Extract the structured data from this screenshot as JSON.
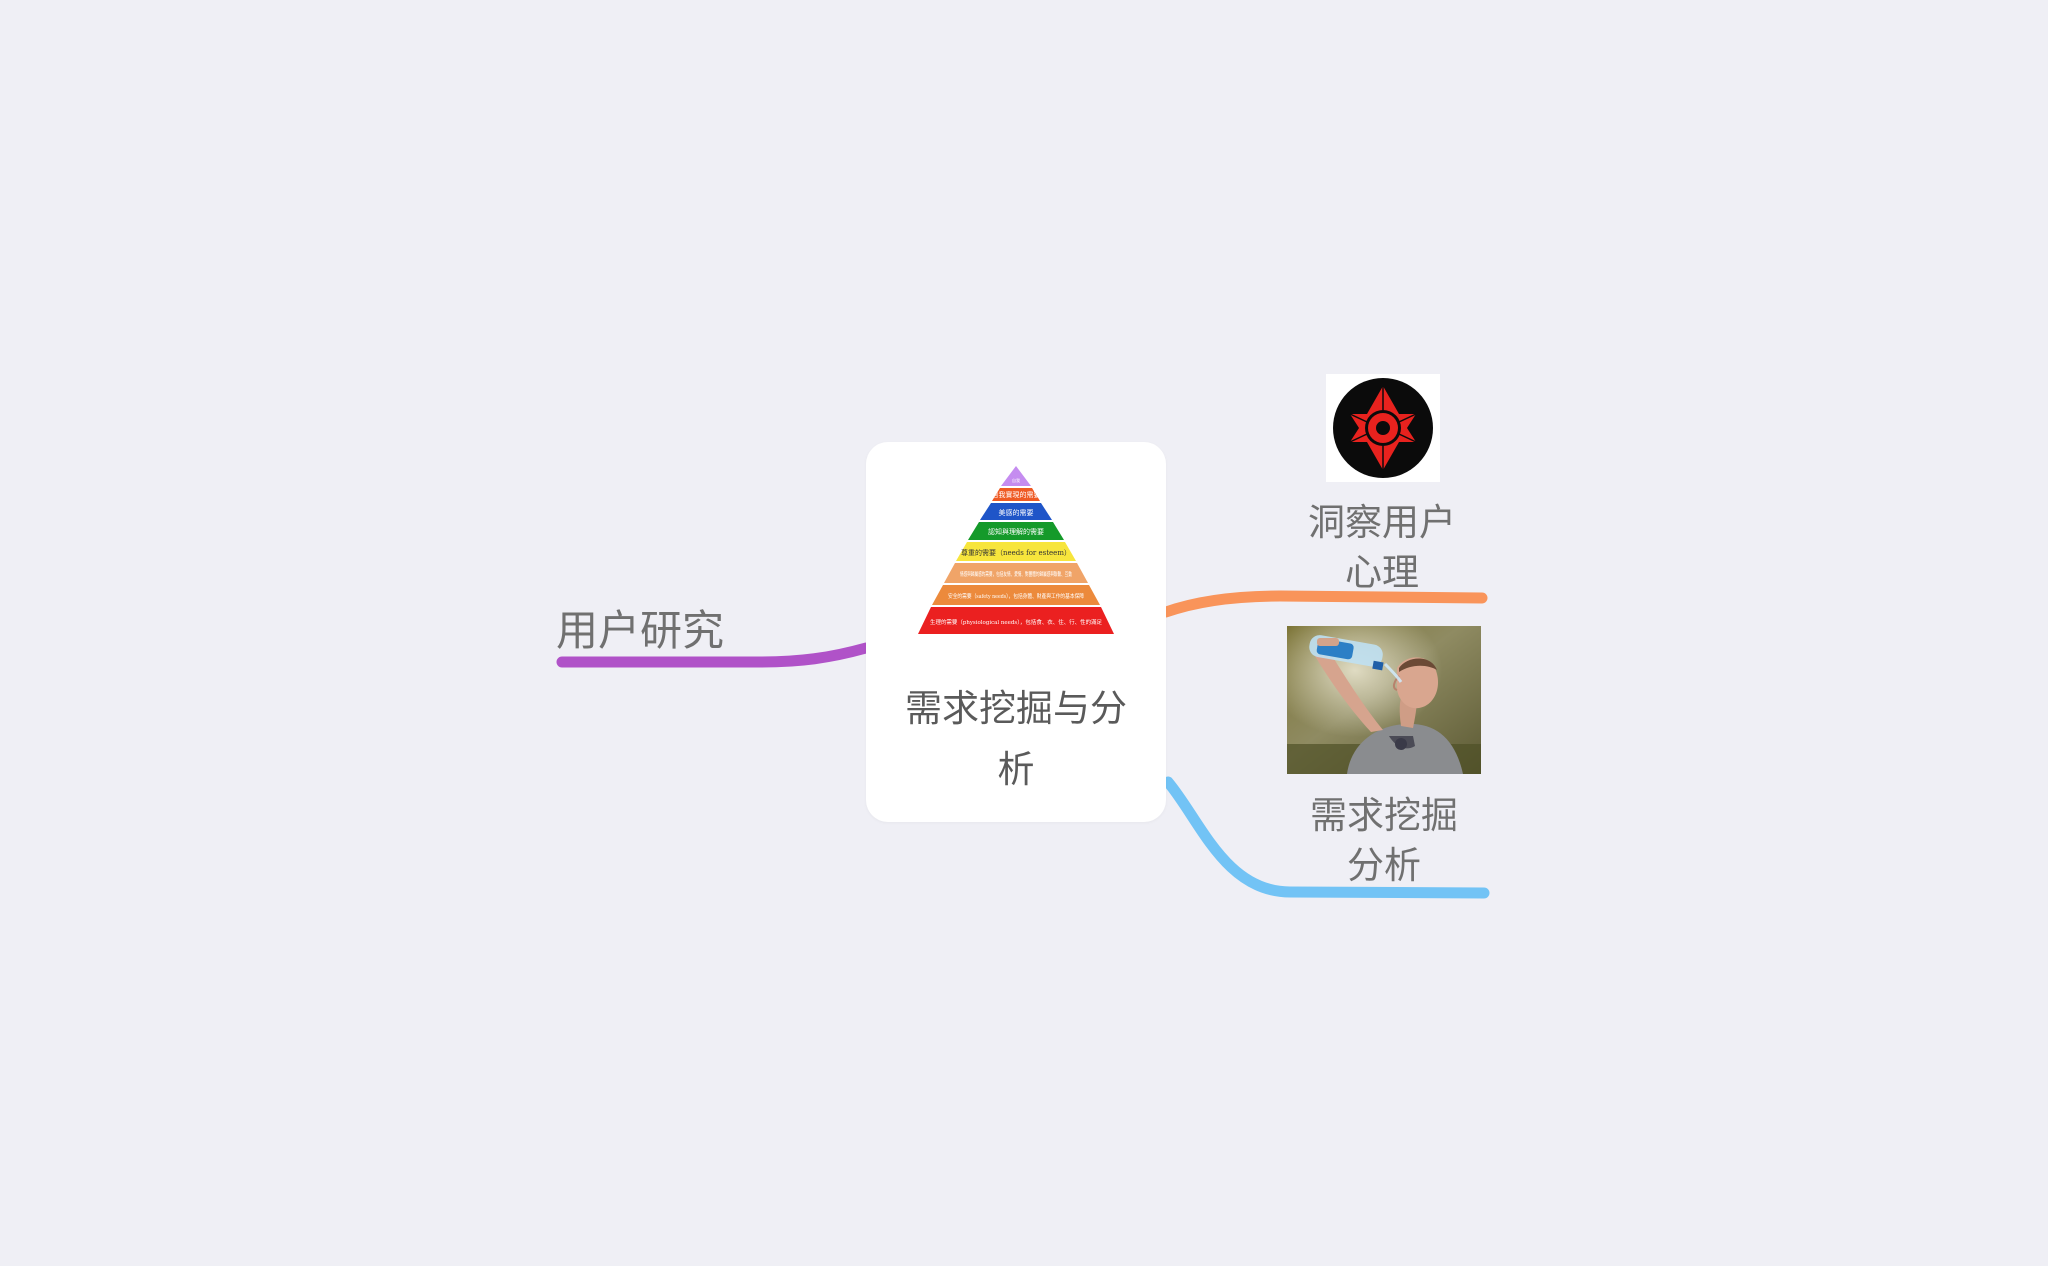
{
  "mindmap": {
    "central": {
      "title": "需求挖掘与分析",
      "pyramid_levels": [
        {
          "text": "自我實現的需要",
          "color": "#c58cf0"
        },
        {
          "text": "自我實現的需要",
          "color": "#ef5a24"
        },
        {
          "text": "美感的需要",
          "color": "#1f55c8"
        },
        {
          "text": "認知與理解的需要",
          "color": "#159a2a"
        },
        {
          "text": "尊重的需要（needs for esteem）",
          "color": "#f7e53c"
        },
        {
          "text": "情感與歸屬感的需要，包括友情、愛情、對團體的歸屬感與聯繫、互動",
          "color": "#f0a468"
        },
        {
          "text": "安全的需要（safety needs），包括身體、財產與工作的基本保障",
          "color": "#ec8a3c"
        },
        {
          "text": "生理的需要（physiological needs），包括食、衣、住、行、性的滿足",
          "color": "#eb2020"
        }
      ]
    },
    "left_topic": {
      "label": "用户研究",
      "color": "#b052c8"
    },
    "right_topics": [
      {
        "label": "洞察用户\n心理",
        "color": "#f9945a",
        "image": "sharingan-icon"
      },
      {
        "label": "需求挖掘\n分析",
        "color": "#72c3f5",
        "image": "man-drinking-water-photo"
      }
    ]
  }
}
